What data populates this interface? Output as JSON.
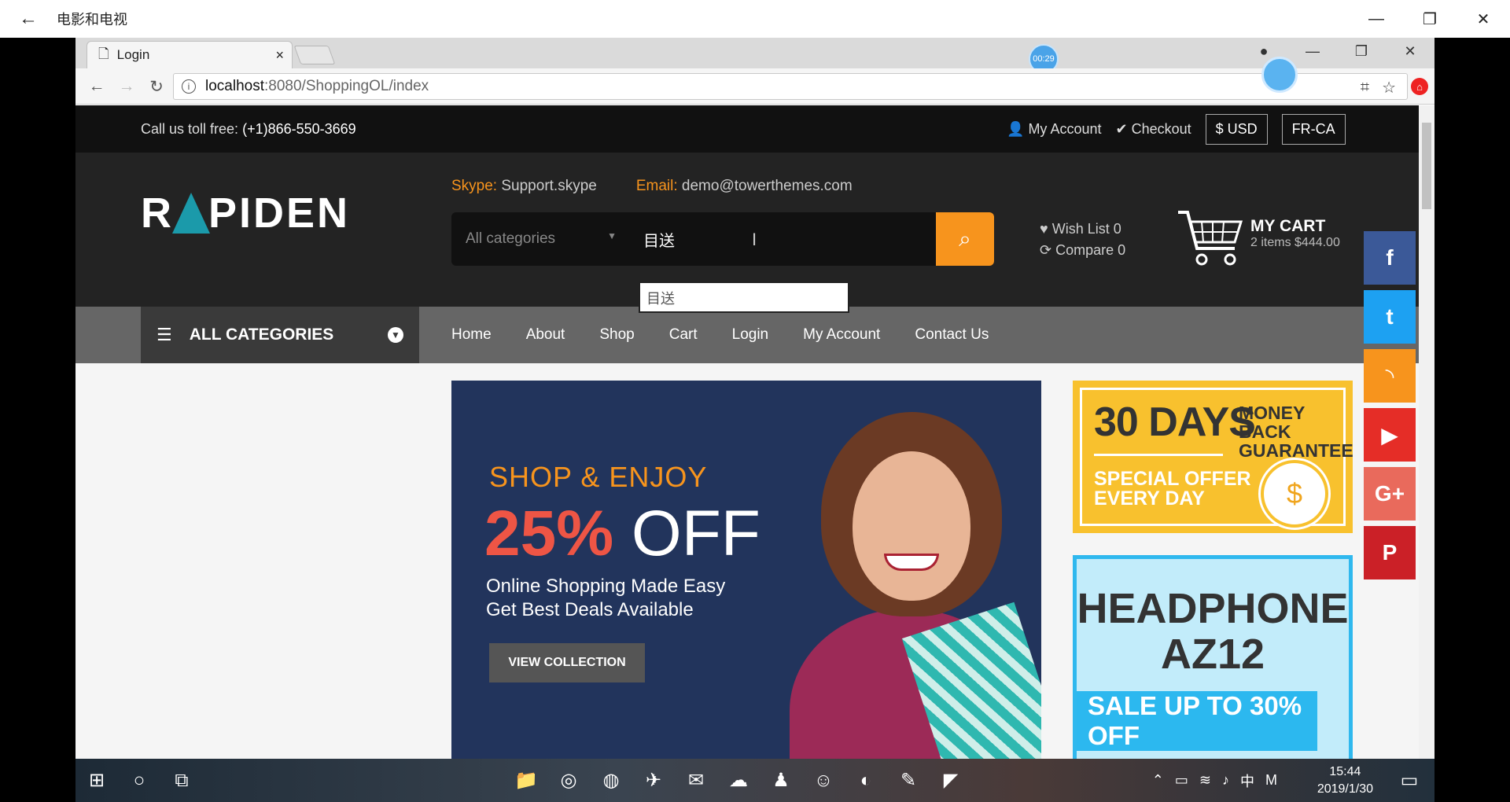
{
  "film_app": {
    "title": "电影和电视"
  },
  "browser": {
    "tab_title": "Login",
    "timer": "00:29",
    "url_host": "localhost",
    "url_path": ":8080/ShoppingOL/index"
  },
  "topbar": {
    "toll_label": "Call us toll free:",
    "toll_number": "(+1)866-550-3669",
    "my_account": "My Account",
    "checkout": "Checkout",
    "currency": "$ USD",
    "language": "FR-CA"
  },
  "header": {
    "logo_left": "R",
    "logo_right": "PIDEN",
    "skype_label": "Skype:",
    "skype_value": "Support.skype",
    "email_label": "Email:",
    "email_value": "demo@towerthemes.com",
    "category_placeholder": "All categories",
    "search_value": "目送",
    "ime_candidate": "目送",
    "wish_list": "Wish List 0",
    "compare": "Compare 0",
    "cart_title": "MY CART",
    "cart_sub": "2 items $444.00"
  },
  "nav": {
    "all_categories": "ALL CATEGORIES",
    "items": [
      "Home",
      "About",
      "Shop",
      "Cart",
      "Login",
      "My Account",
      "Contact Us"
    ]
  },
  "banner": {
    "headline": "SHOP & ENJOY",
    "percent": "25%",
    "off": "OFF",
    "sub1": "Online Shopping Made Easy",
    "sub2": "Get Best Deals Available",
    "button": "VIEW COLLECTION"
  },
  "ad1": {
    "days": "30 DAYS",
    "money_back": "MONEY BACK",
    "guarantee": "GUARANTEE",
    "offer1": "SPECIAL OFFER",
    "offer2": "EVERY DAY"
  },
  "ad2": {
    "title1": "HEADPHONE",
    "title2": "AZ12",
    "sale": "SALE UP TO 30% OFF"
  },
  "social": [
    {
      "name": "facebook",
      "glyph": "f",
      "color": "#3b5998"
    },
    {
      "name": "twitter",
      "glyph": "t",
      "color": "#1da1f2"
    },
    {
      "name": "rss",
      "glyph": "◝",
      "color": "#f7941d"
    },
    {
      "name": "youtube",
      "glyph": "▶",
      "color": "#e52d27"
    },
    {
      "name": "google-plus",
      "glyph": "G+",
      "color": "#e96a5c"
    },
    {
      "name": "pinterest",
      "glyph": "P",
      "color": "#cb2027"
    }
  ],
  "taskbar": {
    "time": "15:44",
    "date": "2019/1/30",
    "ime": "中",
    "ime_mode": "M"
  }
}
